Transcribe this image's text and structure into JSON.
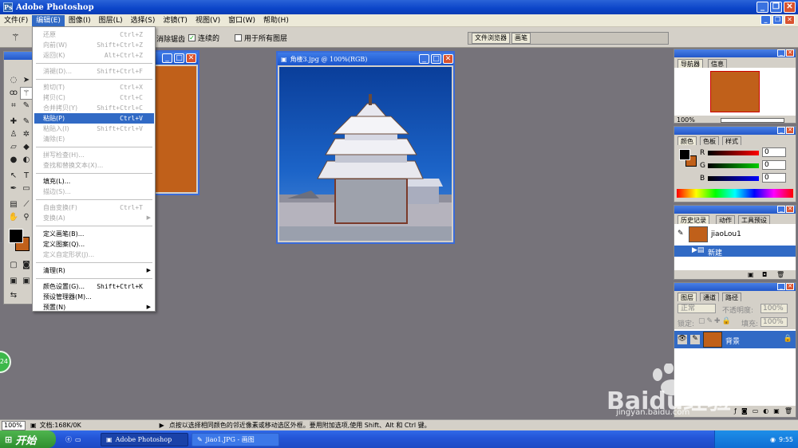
{
  "window": {
    "title": "Adobe Photoshop"
  },
  "menubar": {
    "items": [
      "文件(F)",
      "编辑(E)",
      "图像(I)",
      "图层(L)",
      "选择(S)",
      "滤镜(T)",
      "视图(V)",
      "窗口(W)",
      "帮助(H)"
    ]
  },
  "options": {
    "antialias": "消除锯齿",
    "contiguous": "连续的",
    "all_layers": "用于所有图层",
    "file_browser": "文件浏览器",
    "brushes": "画笔"
  },
  "edit_menu": {
    "items": [
      {
        "label": "还原",
        "shortcut": "Ctrl+Z",
        "disabled": true
      },
      {
        "label": "向前(W)",
        "shortcut": "Shift+Ctrl+Z",
        "disabled": true
      },
      {
        "label": "返回(K)",
        "shortcut": "Alt+Ctrl+Z",
        "disabled": true
      },
      {
        "sep": true
      },
      {
        "label": "消褪(D)...",
        "shortcut": "Shift+Ctrl+F",
        "disabled": true
      },
      {
        "sep": true
      },
      {
        "label": "剪切(T)",
        "shortcut": "Ctrl+X",
        "disabled": true
      },
      {
        "label": "拷贝(C)",
        "shortcut": "Ctrl+C",
        "disabled": true
      },
      {
        "label": "合并拷贝(Y)",
        "shortcut": "Shift+Ctrl+C",
        "disabled": true
      },
      {
        "label": "粘贴(P)",
        "shortcut": "Ctrl+V",
        "highlighted": true
      },
      {
        "label": "粘贴入(I)",
        "shortcut": "Shift+Ctrl+V",
        "disabled": true
      },
      {
        "label": "清除(E)",
        "shortcut": "",
        "disabled": true
      },
      {
        "sep": true
      },
      {
        "label": "拼写检查(H)...",
        "shortcut": "",
        "disabled": true
      },
      {
        "label": "查找和替换文本(X)...",
        "shortcut": "",
        "disabled": true
      },
      {
        "sep": true
      },
      {
        "label": "填充(L)...",
        "shortcut": ""
      },
      {
        "label": "描边(S)...",
        "shortcut": "",
        "disabled": true
      },
      {
        "sep": true
      },
      {
        "label": "自由变换(F)",
        "shortcut": "Ctrl+T",
        "disabled": true
      },
      {
        "label": "变换(A)",
        "shortcut": "",
        "disabled": true,
        "submenu": true
      },
      {
        "sep": true
      },
      {
        "label": "定义画笔(B)...",
        "shortcut": ""
      },
      {
        "label": "定义图案(Q)...",
        "shortcut": ""
      },
      {
        "label": "定义自定形状(J)...",
        "shortcut": "",
        "disabled": true
      },
      {
        "sep": true
      },
      {
        "label": "清理(R)",
        "shortcut": "",
        "submenu": true
      },
      {
        "sep": true
      },
      {
        "label": "颜色设置(G)...",
        "shortcut": "Shift+Ctrl+K"
      },
      {
        "label": "预设管理器(M)...",
        "shortcut": ""
      },
      {
        "label": "预置(N)",
        "shortcut": "",
        "submenu": true
      }
    ]
  },
  "doc_window": {
    "title": "角楼3.jpg @ 100%(RGB)"
  },
  "navigator": {
    "tabs": [
      "导航器",
      "信息"
    ],
    "zoom": "100%"
  },
  "color_panel": {
    "tabs": [
      "颜色",
      "色板",
      "样式"
    ],
    "r_label": "R",
    "g_label": "G",
    "b_label": "B",
    "r": "0",
    "g": "0",
    "b": "0"
  },
  "history_panel": {
    "tabs": [
      "历史记录",
      "动作",
      "工具预设"
    ],
    "snapshot": "jiaoLou1",
    "step": "新建"
  },
  "layers_panel": {
    "tabs": [
      "图层",
      "通道",
      "路径"
    ],
    "blend": "正常",
    "opacity_label": "不透明度:",
    "opacity": "100%",
    "lock_label": "锁定:",
    "fill_label": "填充:",
    "fill": "100%",
    "layer": "背景"
  },
  "status": {
    "zoom": "100%",
    "doc": "文档:168K/0K",
    "hint": "点按以选择相同颜色的邻近像素或移动选区外框。要用附加选项,使用 Shift、Alt 和 Ctrl 键。"
  },
  "taskbar": {
    "start": "开始",
    "task1": "Adobe Photoshop",
    "task2": "jiao1.JPG - 画图",
    "time": "9:55"
  },
  "watermark": {
    "brand": "Baidu经验",
    "url": "jingyan.baidu.com"
  },
  "colors": {
    "swatch": "#c0601a",
    "highlight": "#316ac5"
  }
}
